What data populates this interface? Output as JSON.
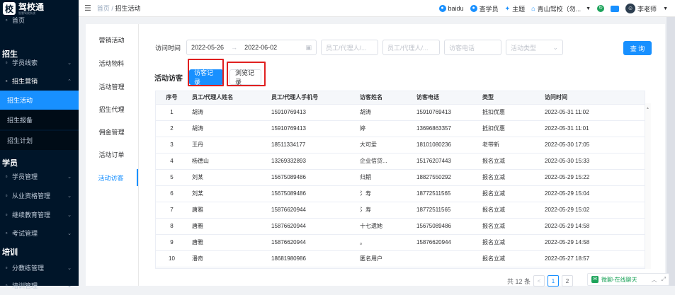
{
  "app": {
    "logo_char": "校",
    "logo_title": "驾校通",
    "logo_sub": "智慧驾校系统"
  },
  "sidebar": {
    "items": [
      {
        "label": "首页",
        "icon": "home-icon",
        "kind": "item"
      },
      {
        "label": "招生",
        "kind": "section"
      },
      {
        "label": "学员线索",
        "icon": "user-lead-icon",
        "kind": "item",
        "chevron": "⌄"
      },
      {
        "label": "招生营销",
        "icon": "marketing-icon",
        "kind": "item-open",
        "chevron": "⌃"
      },
      {
        "label": "招生活动",
        "kind": "sub-active"
      },
      {
        "label": "招生报备",
        "kind": "sub"
      },
      {
        "label": "招生计划",
        "kind": "sub"
      },
      {
        "label": "学员",
        "kind": "section"
      },
      {
        "label": "学员管理",
        "icon": "student-icon",
        "kind": "item",
        "chevron": "⌄"
      },
      {
        "label": "从业资格管理",
        "icon": "qualification-icon",
        "kind": "item",
        "chevron": "⌄"
      },
      {
        "label": "继续教育管理",
        "icon": "education-icon",
        "kind": "item",
        "chevron": "⌄"
      },
      {
        "label": "考试管理",
        "icon": "exam-icon",
        "kind": "item",
        "chevron": "⌄"
      },
      {
        "label": "培训",
        "kind": "section"
      },
      {
        "label": "分教练管理",
        "icon": "coach-icon",
        "kind": "item",
        "chevron": "⌄"
      },
      {
        "label": "培训管理",
        "icon": "training-icon",
        "kind": "item",
        "chevron": "⌄"
      }
    ]
  },
  "header": {
    "breadcrumb_home": "首页",
    "breadcrumb_sep": "/",
    "breadcrumb_current": "招生活动",
    "links": [
      {
        "label": "baidu",
        "color": "#1890ff",
        "icon": "baidu-icon"
      },
      {
        "label": "查学员",
        "color": "#1890ff",
        "icon": "search-student-icon"
      },
      {
        "label": "主题",
        "color": "#1890ff",
        "icon": "theme-icon"
      },
      {
        "label": "青山驾校（勿...",
        "color": "#1890ff",
        "icon": "school-icon"
      }
    ],
    "user": "李老师"
  },
  "leftnav": [
    "营销活动",
    "活动物料",
    "活动管理",
    "招生代理",
    "佣金管理",
    "活动订单",
    "活动访客"
  ],
  "filters": {
    "label": "访问时间",
    "date_start": "2022-05-26",
    "date_sep": "→",
    "date_end": "2022-06-02",
    "ph_agent1": "员工/代理人/...",
    "ph_agent2": "员工/代理人/...",
    "ph_phone": "访客电话",
    "ph_type": "活动类型",
    "query": "查 询"
  },
  "section": {
    "title": "活动访客",
    "tab_visitor": "访客记录",
    "tab_browse": "浏览记录"
  },
  "table": {
    "headers": [
      "序号",
      "员工/代理人姓名",
      "员工/代理人手机号",
      "访客姓名",
      "访客电话",
      "类型",
      "访问时间"
    ],
    "rows": [
      [
        "1",
        "胡涛",
        "15910769413",
        "胡涛",
        "15910769413",
        "抵扣优惠",
        "2022-05-31 11:02"
      ],
      [
        "2",
        "胡涛",
        "15910769413",
        "婷",
        "13696863357",
        "抵扣优惠",
        "2022-05-31 11:01"
      ],
      [
        "3",
        "王丹",
        "18511334177",
        "大可爱",
        "18101080236",
        "老带新",
        "2022-05-30 17:05"
      ],
      [
        "4",
        "杨德山",
        "13269332893",
        "企业信贷...",
        "15176207443",
        "报名立减",
        "2022-05-30 15:33"
      ],
      [
        "5",
        "刘某",
        "15675089486",
        "归期",
        "18827550292",
        "报名立减",
        "2022-05-29 15:22"
      ],
      [
        "6",
        "刘某",
        "15675089486",
        "氵寿",
        "18772511565",
        "报名立减",
        "2022-05-29 15:04"
      ],
      [
        "7",
        "唐雅",
        "15876620944",
        "氵寿",
        "18772511565",
        "报名立减",
        "2022-05-29 15:02"
      ],
      [
        "8",
        "唐雅",
        "15876620944",
        "十七遗她",
        "15675089486",
        "报名立减",
        "2022-05-29 14:58"
      ],
      [
        "9",
        "唐雅",
        "15876620944",
        "。",
        "15876620944",
        "报名立减",
        "2022-05-29 14:58"
      ],
      [
        "10",
        "潘奇",
        "18681980986",
        "匿名用户",
        "",
        "报名立减",
        "2022-05-27 18:57"
      ]
    ]
  },
  "pager": {
    "total": "共 12 条",
    "prev": "<",
    "page1": "1",
    "page2": "2"
  },
  "chat": {
    "label": "微聊-在线聊天"
  }
}
